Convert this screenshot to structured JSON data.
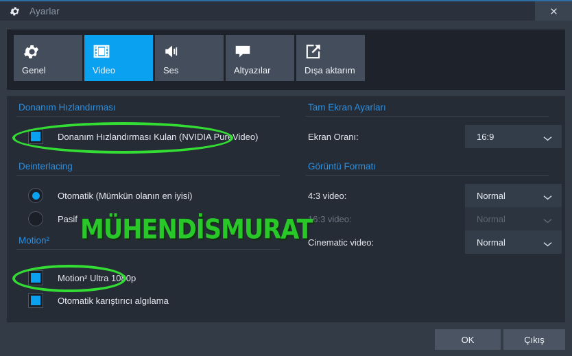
{
  "window": {
    "title": "Ayarlar",
    "gear_icon": "gear-icon",
    "close_icon": "close-icon"
  },
  "tabs": [
    {
      "label": "Genel",
      "icon": "gear-icon",
      "active": false
    },
    {
      "label": "Video",
      "icon": "film-icon",
      "active": true
    },
    {
      "label": "Ses",
      "icon": "speaker-icon",
      "active": false
    },
    {
      "label": "Altyazılar",
      "icon": "caption-bubble-icon",
      "active": false
    },
    {
      "label": "Dışa aktarım",
      "icon": "export-arrow-icon",
      "active": false
    }
  ],
  "left": {
    "hw_section_title": "Donanım Hızlandırması",
    "hw_checkbox_label": "Donanım Hızlandırması Kulan  (NVIDIA PureVideo)",
    "deinterlacing_title": "Deinterlacing",
    "radio_auto": "Otomatik (Mümkün olanın en iyisi)",
    "radio_off": "Pasif",
    "motion_title": "Motion²",
    "motion_checkbox_label": "Motion²  Ultra 1080p",
    "auto_blend_label": "Otomatik karıştırıcı algılama"
  },
  "right": {
    "fullscreen_title": "Tam Ekran Ayarları",
    "aspect_label": "Ekran Oranı:",
    "aspect_value": "16:9",
    "image_format_title": "Görüntü Formatı",
    "rows": [
      {
        "label": "4:3 video:",
        "value": "Normal",
        "disabled": false
      },
      {
        "label": "16:3 video:",
        "value": "Normal",
        "disabled": true
      },
      {
        "label": "Cinematic video:",
        "value": "Normal",
        "disabled": false
      }
    ]
  },
  "buttons": {
    "ok": "OK",
    "exit": "Çıkış"
  },
  "annotation": {
    "watermark_text": "MÜHENDİSMURAT",
    "highlight_color": "#33dd33",
    "watermark_color": "#28c828"
  },
  "colors": {
    "accent": "#0aa2f0",
    "section_heading": "#2b8fe0",
    "panel_bg": "#262c36",
    "window_bg": "#333b47"
  }
}
